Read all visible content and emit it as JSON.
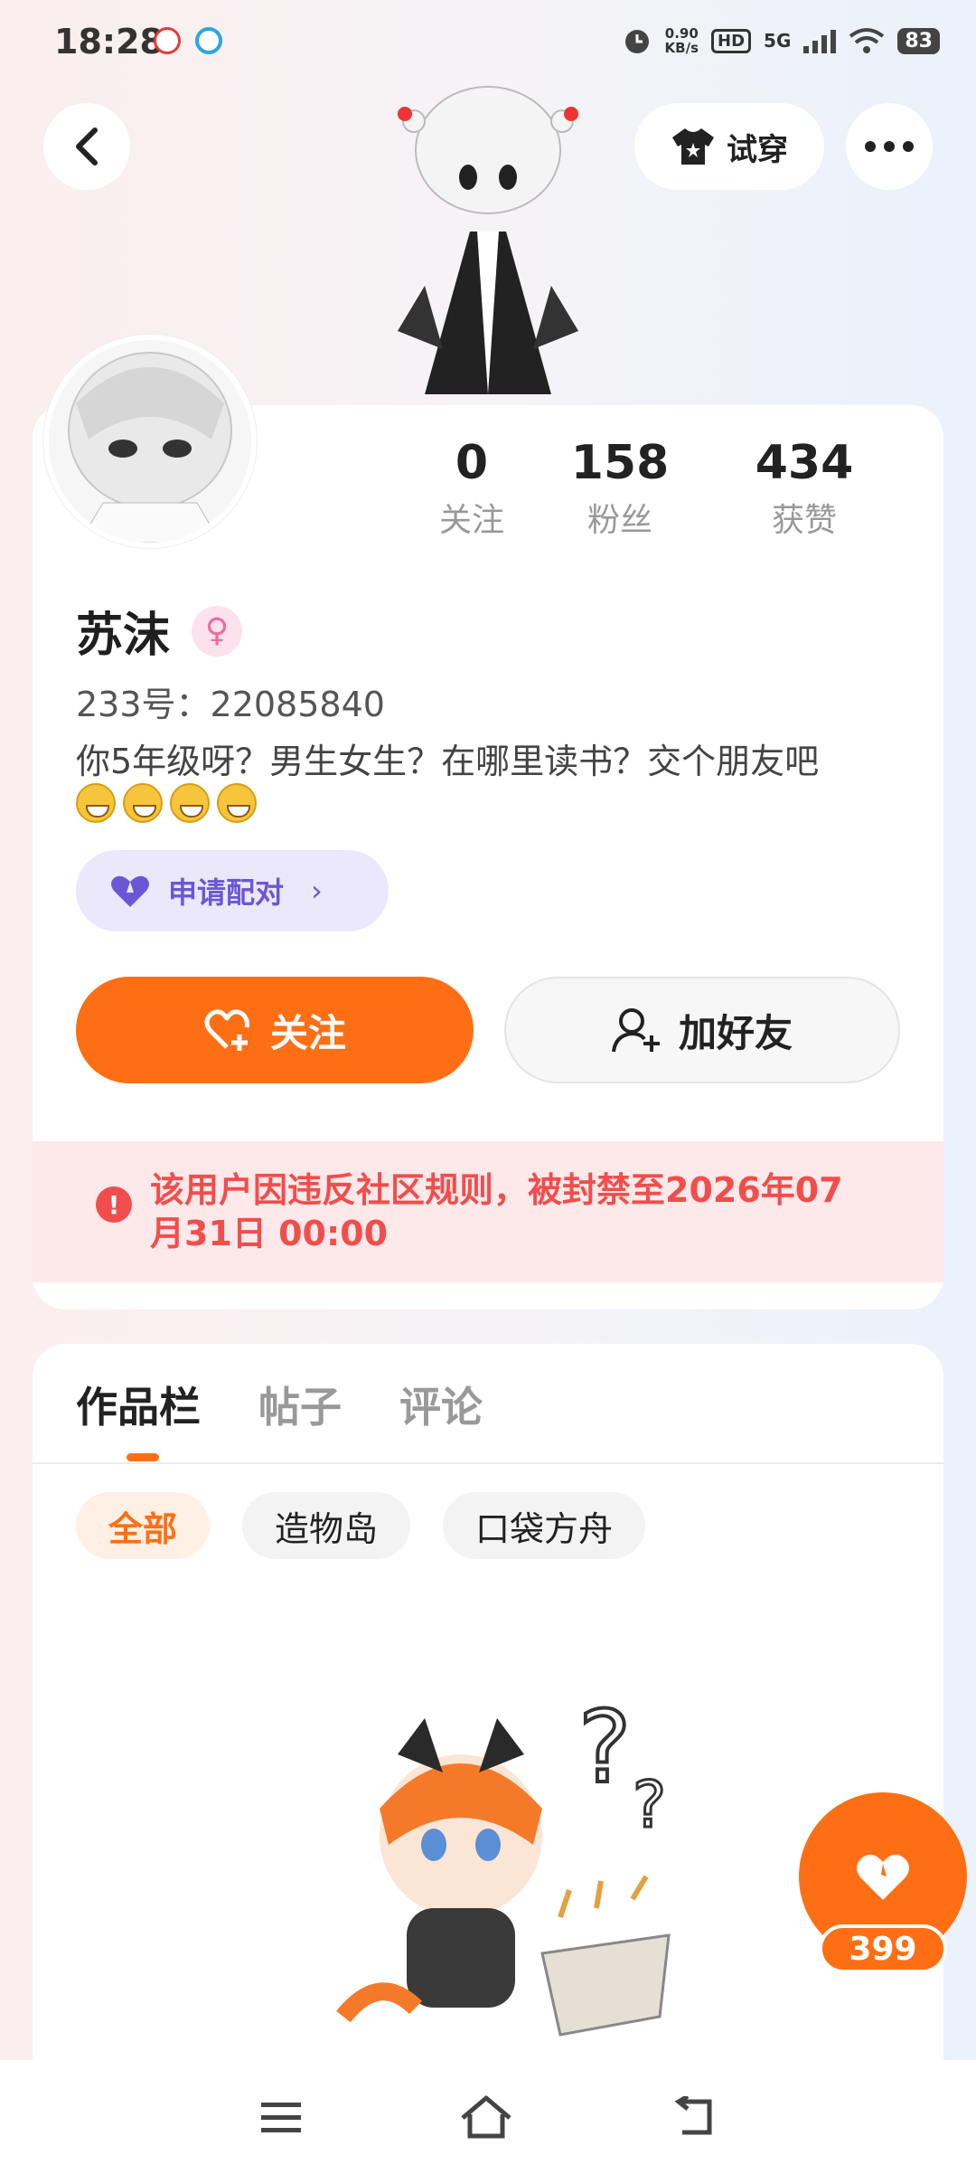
{
  "status_bar": {
    "time": "18:28",
    "speed_value": "0.90",
    "speed_unit": "KB/s",
    "hd": "HD",
    "network": "5G",
    "battery": "83"
  },
  "header": {
    "tryon_label": "试穿"
  },
  "profile": {
    "stats": [
      {
        "value": "0",
        "label": "关注"
      },
      {
        "value": "158",
        "label": "粉丝"
      },
      {
        "value": "434",
        "label": "获赞"
      }
    ],
    "username": "苏沫",
    "gender_symbol": "♀",
    "uid_text": "233号：22085840",
    "bio": "你5年级呀？男生女生？在哪里读书？交个朋友吧",
    "pair_label": "申请配对",
    "follow_label": "关注",
    "add_friend_label": "加好友",
    "ban_notice": "该用户因违反社区规则，被封禁至2026年07月31日 00:00"
  },
  "content": {
    "tabs": [
      "作品栏",
      "帖子",
      "评论"
    ],
    "filters": [
      "全部",
      "造物岛",
      "口袋方舟"
    ]
  },
  "like_fab": {
    "count": "399"
  },
  "colors": {
    "accent": "#fe6f15",
    "ban_text": "#f24d4d",
    "pair_purple": "#6b57d6"
  }
}
